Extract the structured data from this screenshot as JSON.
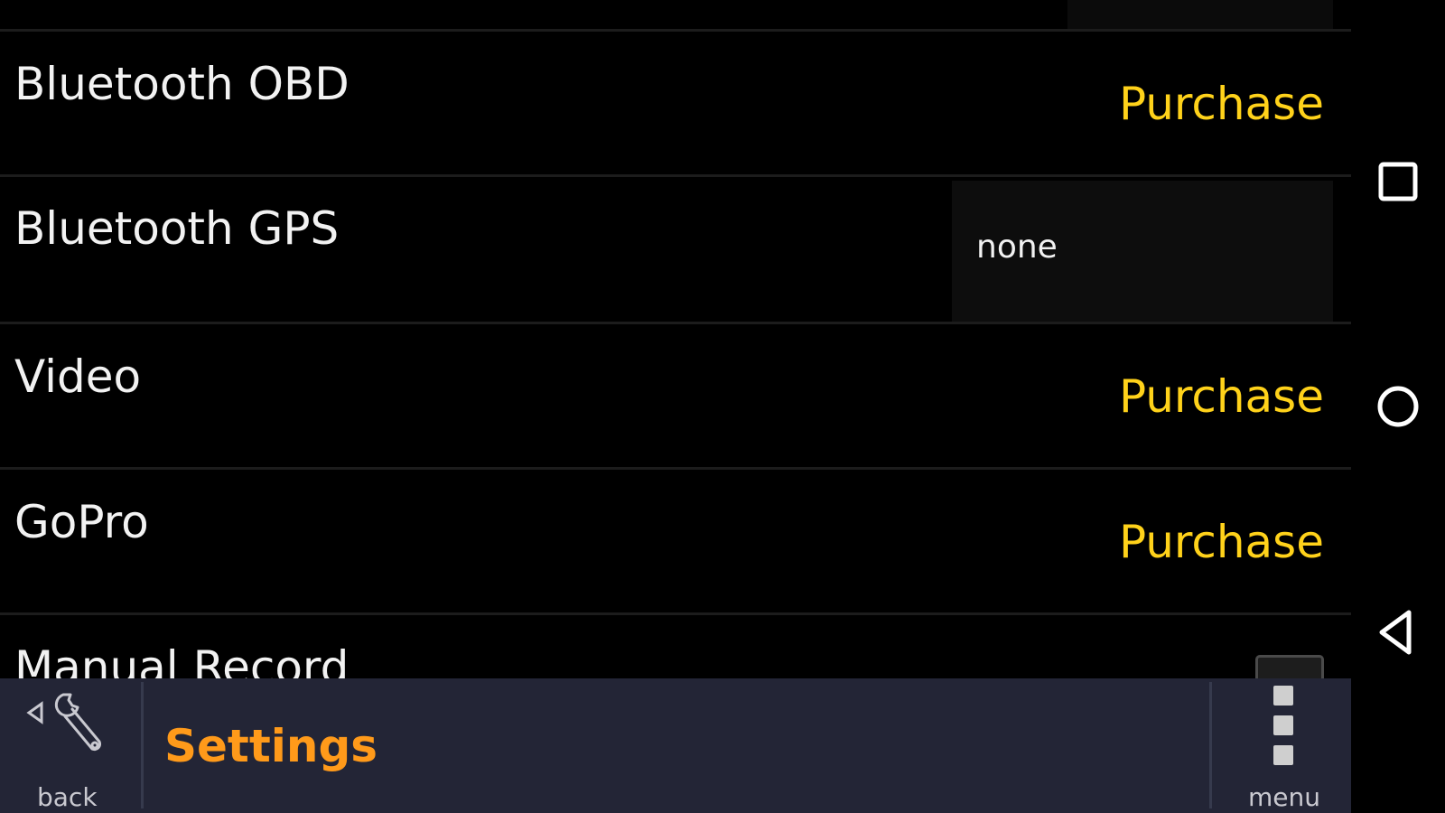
{
  "settings": {
    "rows": [
      {
        "label": "Bluetooth OBD",
        "action": "Purchase"
      },
      {
        "label": "Bluetooth GPS",
        "value": "none"
      },
      {
        "label": "Video",
        "action": "Purchase"
      },
      {
        "label": "GoPro",
        "action": "Purchase"
      },
      {
        "label": "Manual Record",
        "checked": false
      }
    ]
  },
  "bottombar": {
    "back_label": "back",
    "title": "Settings",
    "menu_label": "menu"
  },
  "colors": {
    "background": "#000000",
    "label_text": "#f2f2f2",
    "purchase_accent": "#ffd21a",
    "title_accent": "#ff9a1a",
    "bottombar_bg": "#232536"
  },
  "icons": {
    "back": "wrench-back-icon",
    "menu": "vertical-dots-icon",
    "nav_recents": "square-icon",
    "nav_home": "circle-icon",
    "nav_back": "triangle-back-icon"
  }
}
